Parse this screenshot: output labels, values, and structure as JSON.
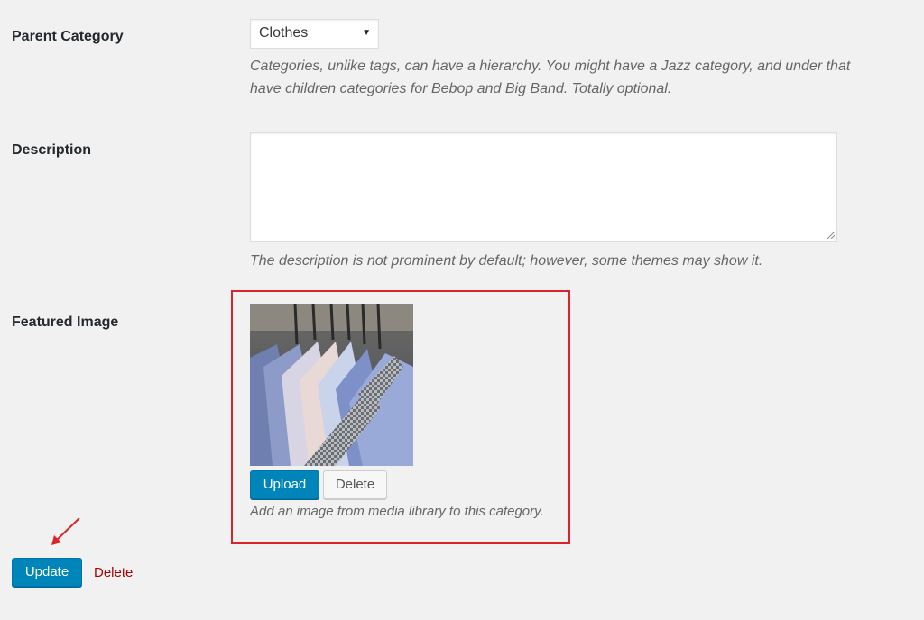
{
  "parent_category": {
    "label": "Parent Category",
    "selected": "Clothes",
    "help_line1": "Categories, unlike tags, can have a hierarchy. You might have a Jazz category, and under that",
    "help_line2": "have children categories for Bebop and Big Band. Totally optional."
  },
  "description": {
    "label": "Description",
    "value": "",
    "help": "The description is not prominent by default; however, some themes may show it."
  },
  "featured_image": {
    "label": "Featured Image",
    "upload_label": "Upload",
    "delete_label": "Delete",
    "help": "Add an image from media library to this category."
  },
  "footer": {
    "update_label": "Update",
    "delete_label": "Delete"
  },
  "colors": {
    "primary": "#0085ba",
    "highlight": "#d9242b",
    "delete_link": "#a00"
  },
  "icons": {
    "select_caret": "caret-down-icon",
    "annotation": "arrow-icon"
  }
}
